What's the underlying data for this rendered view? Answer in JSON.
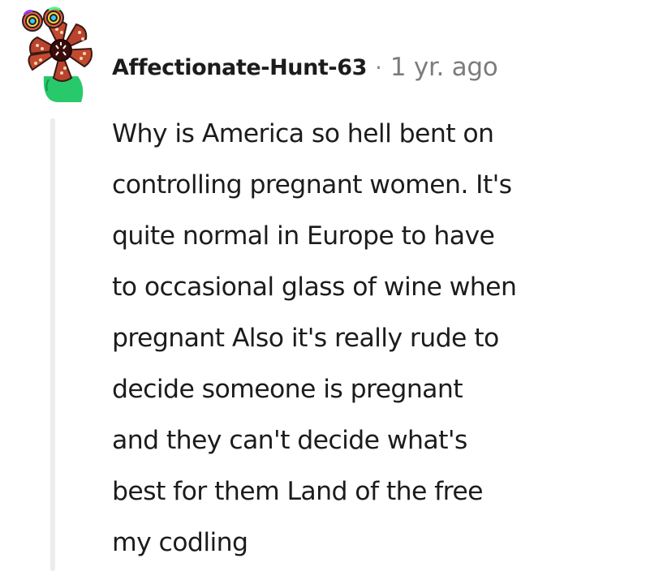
{
  "comment": {
    "author": "Affectionate-Hunt-63",
    "separator": "·",
    "timestamp": "1 yr. ago",
    "avatar_icon": "demogorgon-avatar-icon",
    "body": "Why is America so hell bent on\ncontrolling pregnant women. It's\nquite normal in Europe to have\nto occasional glass of wine when\npregnant Also it's really rude to\ndecide someone is pregnant\nand they can't decide what's\nbest for them Land of the free\nmy codling"
  },
  "colors": {
    "author": "#1c1c1c",
    "meta": "#7c7c7c",
    "thread_line": "#ededed",
    "background": "#ffffff"
  }
}
